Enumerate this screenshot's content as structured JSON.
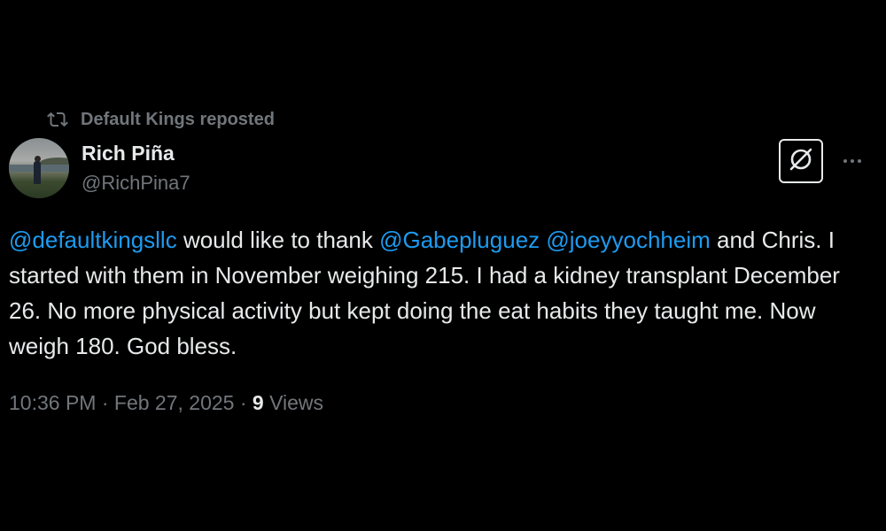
{
  "social_context": {
    "icon": "repost-icon",
    "text": "Default Kings reposted"
  },
  "author": {
    "display_name": "Rich Piña",
    "handle": "@RichPina7",
    "avatar": "profile-photo"
  },
  "actions": {
    "grok_icon": "grok-icon",
    "more_icon": "more-options-icon"
  },
  "tweet": {
    "segments": [
      {
        "text": "@defaultkingsllc",
        "type": "mention"
      },
      {
        "text": " would like to thank ",
        "type": "text"
      },
      {
        "text": "@Gabepluguez",
        "type": "mention"
      },
      {
        "text": " ",
        "type": "text"
      },
      {
        "text": "@joeyyochheim",
        "type": "mention"
      },
      {
        "text": " and Chris. I started with them in November weighing 215. I had a kidney transplant December 26. No more physical activity but kept doing the eat habits they taught me. Now weigh 180. God bless.",
        "type": "text"
      }
    ]
  },
  "meta": {
    "time": "10:36 PM",
    "separator": "·",
    "date": "Feb 27, 2025",
    "views_count": "9",
    "views_label": "Views"
  },
  "colors": {
    "background": "#000000",
    "text_primary": "#e7e9ea",
    "text_secondary": "#71767b",
    "link": "#1d9bf0"
  }
}
